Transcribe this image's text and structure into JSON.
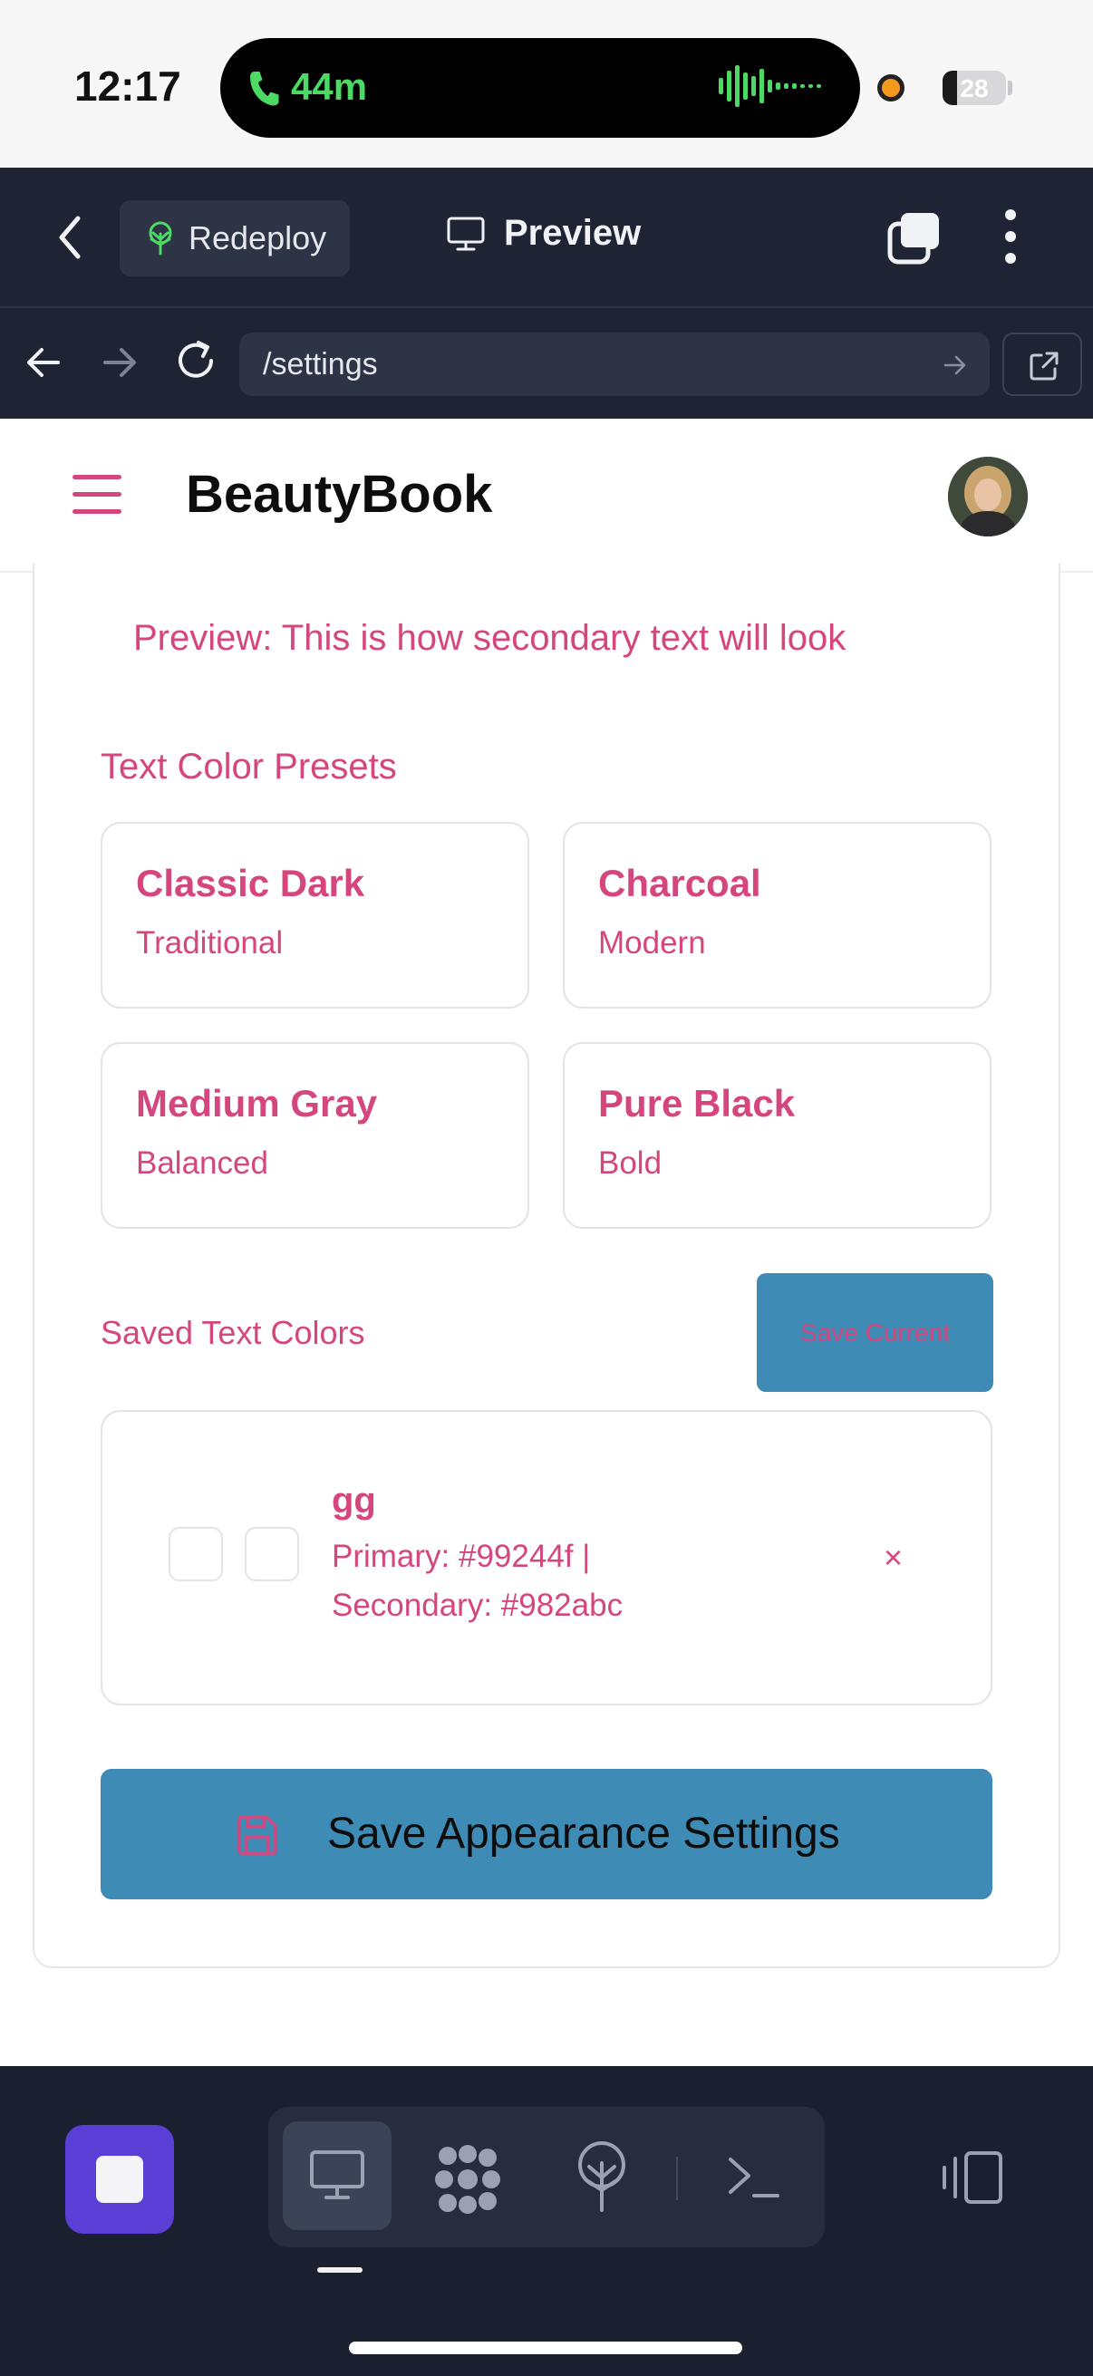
{
  "status_bar": {
    "time": "12:17",
    "call_duration": "44m",
    "battery": "28"
  },
  "toolbar": {
    "redeploy_label": "Redeploy",
    "preview_label": "Preview"
  },
  "address_bar": {
    "url": "/settings"
  },
  "app": {
    "brand": "BeautyBook"
  },
  "settings": {
    "preview_text": "Preview: This is how secondary text will look",
    "presets_title": "Text Color Presets",
    "presets": [
      {
        "name": "Classic Dark",
        "description": "Traditional"
      },
      {
        "name": "Charcoal",
        "description": "Modern"
      },
      {
        "name": "Medium Gray",
        "description": "Balanced"
      },
      {
        "name": "Pure Black",
        "description": "Bold"
      }
    ],
    "saved_title": "Saved Text Colors",
    "save_current_label": "Save Current",
    "saved_colors": [
      {
        "name": "gg",
        "primary_line": "Primary: #99244f |",
        "secondary_line": "Secondary: #982abc",
        "remove_label": "×"
      }
    ],
    "save_button_label": "Save Appearance Settings"
  },
  "colors": {
    "accent_pink": "#d4467d",
    "button_blue": "#3e8bb5",
    "toolbar_bg": "#1e2433",
    "stop_purple": "#5b3ed6",
    "call_green": "#4cd964"
  }
}
